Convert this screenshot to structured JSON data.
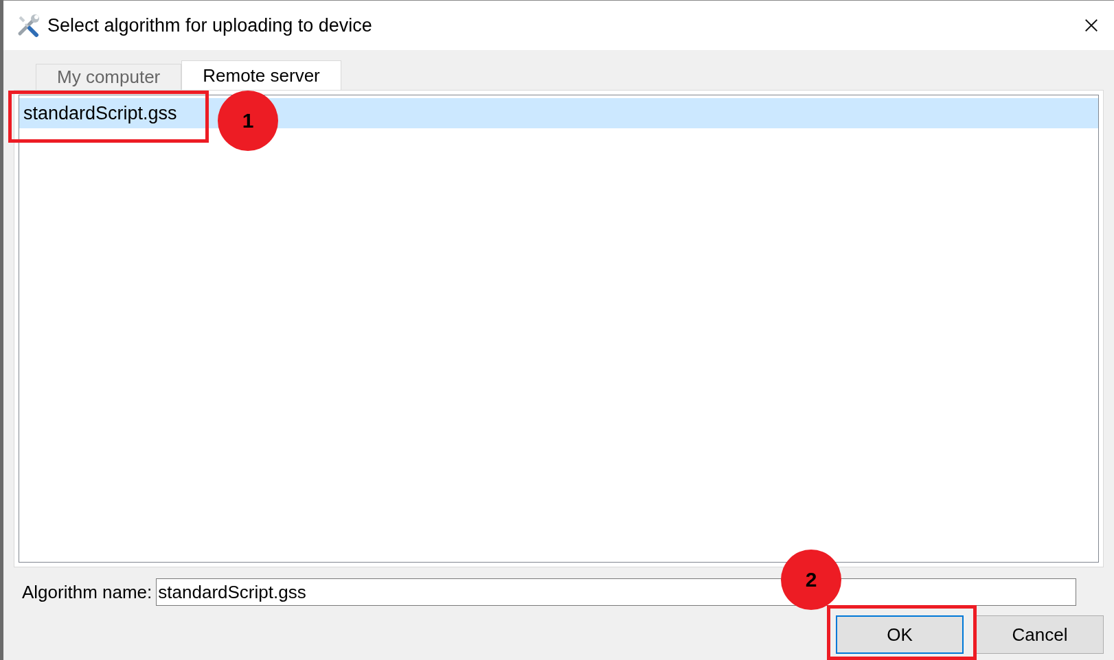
{
  "window": {
    "title": "Select algorithm for uploading to device"
  },
  "tabs": [
    {
      "label": "My computer",
      "selected": false
    },
    {
      "label": "Remote server",
      "selected": true
    }
  ],
  "file_list": {
    "items": [
      {
        "name": "standardScript.gss",
        "selected": true
      }
    ]
  },
  "algorithm_name": {
    "label": "Algorithm name:",
    "value": "standardScript.gss"
  },
  "buttons": [
    {
      "label": "OK",
      "default": true
    },
    {
      "label": "Cancel",
      "default": false
    }
  ],
  "annotations": [
    {
      "number": "1"
    },
    {
      "number": "2"
    }
  ]
}
